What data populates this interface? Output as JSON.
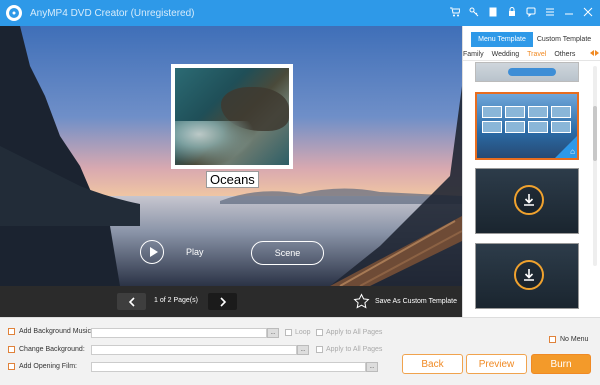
{
  "window": {
    "title": "AnyMP4 DVD Creator (Unregistered)",
    "toolbar_icons": [
      "cart-icon",
      "key-icon",
      "file-icon",
      "lock-icon",
      "chat-icon",
      "menu-icon",
      "minimize-icon",
      "close-icon"
    ]
  },
  "preview": {
    "menu_title": "Oceans",
    "play_label": "Play",
    "scene_label": "Scene"
  },
  "pagebar": {
    "page_text": "1 of 2 Page(s)",
    "save_custom": "Save As Custom Template"
  },
  "templates": {
    "tabs": [
      "Menu Template",
      "Custom Template"
    ],
    "active_tab": 0,
    "categories": [
      "Family",
      "Wedding",
      "Travel",
      "Others"
    ],
    "active_category": "Travel",
    "accent": "#f08a24",
    "selected_border": "#e86d1f"
  },
  "options": {
    "bg_music_label": "Add Background Music:",
    "change_bg_label": "Change Background:",
    "opening_film_label": "Add Opening Film:",
    "loop_label": "Loop",
    "apply_all_1": "Apply to All Pages",
    "apply_all_2": "Apply to All Pages",
    "browse": "...",
    "no_menu_label": "No Menu"
  },
  "buttons": {
    "back": "Back",
    "preview": "Preview",
    "burn": "Burn"
  },
  "colors": {
    "titlebar": "#2e99e8",
    "burn": "#f39a2a"
  }
}
